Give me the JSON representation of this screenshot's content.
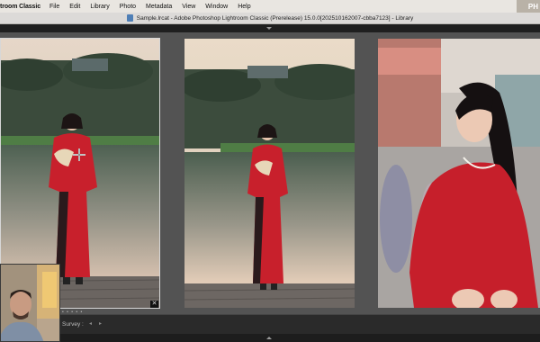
{
  "menubar": {
    "app_name": "troom Classic",
    "items": [
      "File",
      "Edit",
      "Library",
      "Photo",
      "Metadata",
      "View",
      "Window",
      "Help"
    ],
    "corner_text": "PH"
  },
  "window": {
    "title": "Sample.lrcat - Adobe Photoshop Lightroom Classic (Prerelease) 15.0.0[202510162007-cbba7123] - Library"
  },
  "survey": {
    "photos": [
      {
        "name": "photo-1",
        "selected": true
      },
      {
        "name": "photo-2",
        "selected": false
      },
      {
        "name": "photo-3",
        "selected": false
      }
    ],
    "reject_glyph": "✕",
    "dots": "• • • • •"
  },
  "toolbar": {
    "mode_label": "Survey :",
    "tool_icons": [
      "arrow-left-icon",
      "arrow-right-icon"
    ]
  },
  "colors": {
    "background": "#535353",
    "dress_red": "#c8202c",
    "selection_border": "#d7d7d7"
  }
}
